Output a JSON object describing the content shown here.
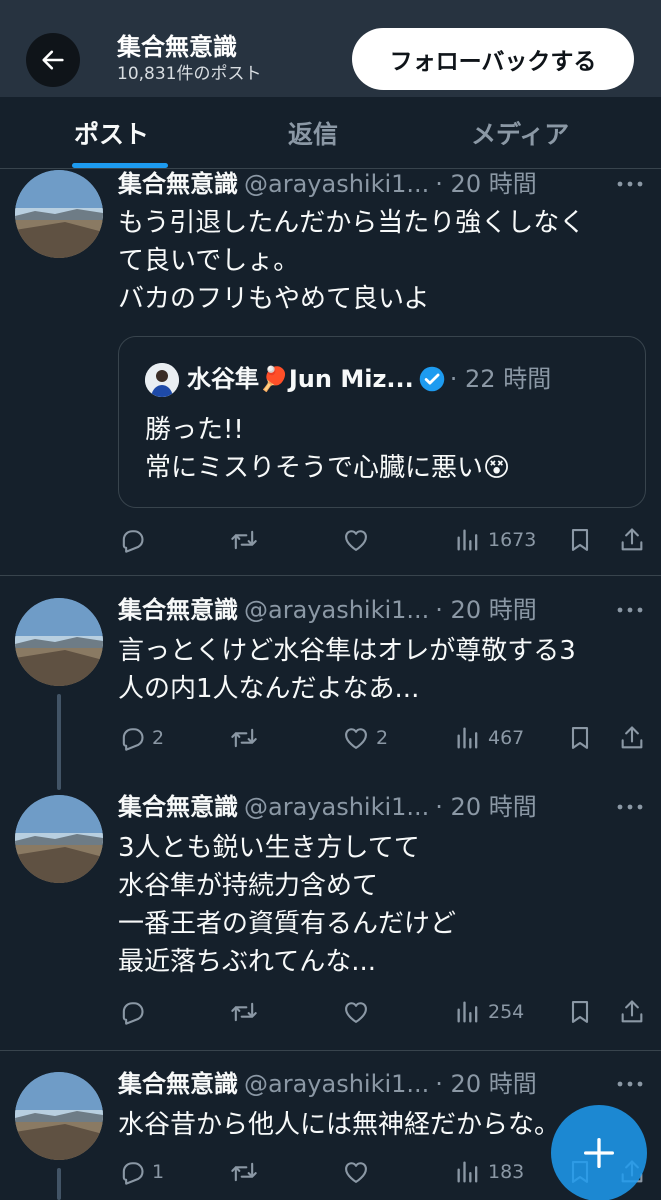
{
  "header": {
    "title": "集合無意識",
    "post_count": "10,831件のポスト",
    "follow_back_label": "フォローバックする"
  },
  "tabs": [
    "ポスト",
    "返信",
    "メディア"
  ],
  "posts": [
    {
      "name": "集合無意識",
      "handle": "@arayashiki1...",
      "time": "· 20 時間",
      "lines": [
        "もう引退したんだから当たり強くしなく",
        "て良いでしょ。",
        "バカのフリもやめて良いよ"
      ],
      "quote": {
        "name": "水谷隼🏓Jun Miz...",
        "time": "· 22 時間",
        "lines": [
          "勝った!!",
          "常にミスりそうで心臓に悪い😵"
        ]
      },
      "replies": "",
      "retweets": "",
      "likes": "",
      "views": "1673"
    },
    {
      "name": "集合無意識",
      "handle": "@arayashiki1...",
      "time": "· 20 時間",
      "lines": [
        "言っとくけど水谷隼はオレが尊敬する3",
        "人の内1人なんだよなあ..."
      ],
      "replies": "2",
      "retweets": "",
      "likes": "2",
      "views": "467"
    },
    {
      "name": "集合無意識",
      "handle": "@arayashiki1...",
      "time": "· 20 時間",
      "lines": [
        "3人とも鋭い生き方してて",
        "水谷隼が持続力含めて",
        "一番王者の資質有るんだけど",
        "最近落ちぶれてんな..."
      ],
      "replies": "",
      "retweets": "",
      "likes": "",
      "views": "254"
    },
    {
      "name": "集合無意識",
      "handle": "@arayashiki1...",
      "time": "· 20 時間",
      "lines": [
        "水谷昔から他人には無神経だからな。"
      ],
      "replies": "1",
      "retweets": "",
      "likes": "",
      "views": "183"
    }
  ],
  "icons": {
    "back": "arrow-left-icon",
    "more": "more-horizontal-icon",
    "reply": "reply-icon",
    "retweet": "retweet-icon",
    "like": "heart-icon",
    "views": "views-chart-icon",
    "bookmark": "bookmark-icon",
    "share": "share-icon",
    "compose": "plus-icon"
  },
  "colors": {
    "background": "#15202b",
    "header": "#273340",
    "accent": "#1d9bf0",
    "text": "#f7f9f9",
    "muted": "#8b98a5",
    "border": "#38444d"
  }
}
